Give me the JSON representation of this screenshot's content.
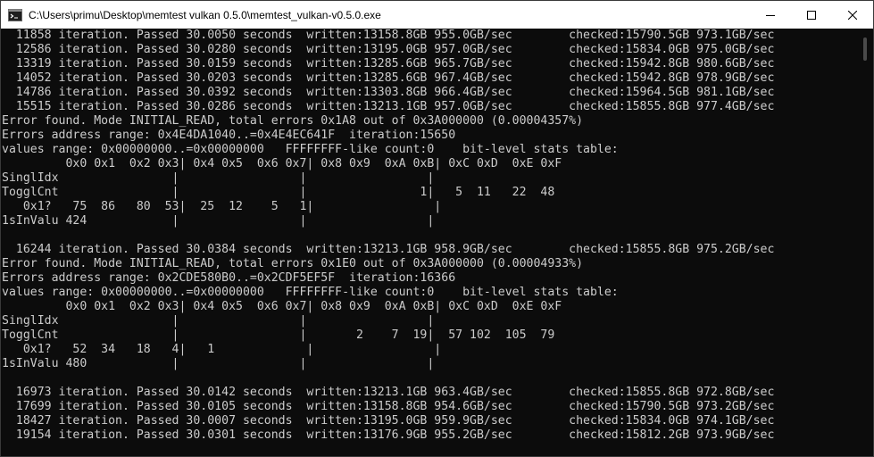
{
  "window": {
    "title": "C:\\Users\\primu\\Desktop\\memtest vulkan 0.5.0\\memtest_vulkan-v0.5.0.exe"
  },
  "colors": {
    "terminal_bg": "#0c0c0c",
    "terminal_fg": "#cccccc",
    "titlebar_bg": "#ffffff"
  },
  "icons": {
    "app": "console-app-icon",
    "minimize": "minimize-icon",
    "maximize": "maximize-icon",
    "close": "close-icon"
  },
  "console": {
    "lines": [
      "  11858 iteration. Passed 30.0050 seconds  written:13158.8GB 955.0GB/sec        checked:15790.5GB 973.1GB/sec",
      "  12586 iteration. Passed 30.0280 seconds  written:13195.0GB 957.0GB/sec        checked:15834.0GB 975.0GB/sec",
      "  13319 iteration. Passed 30.0159 seconds  written:13285.6GB 965.7GB/sec        checked:15942.8GB 980.6GB/sec",
      "  14052 iteration. Passed 30.0203 seconds  written:13285.6GB 967.4GB/sec        checked:15942.8GB 978.9GB/sec",
      "  14786 iteration. Passed 30.0392 seconds  written:13303.8GB 966.4GB/sec        checked:15964.5GB 981.1GB/sec",
      "  15515 iteration. Passed 30.0286 seconds  written:13213.1GB 957.0GB/sec        checked:15855.8GB 977.4GB/sec",
      "Error found. Mode INITIAL_READ, total errors 0x1A8 out of 0x3A000000 (0.00004357%)",
      "Errors address range: 0x4E4DA1040..=0x4E4EC641F  iteration:15650",
      "values range: 0x00000000..=0x00000000   FFFFFFFF-like count:0    bit-level stats table:",
      "         0x0 0x1  0x2 0x3| 0x4 0x5  0x6 0x7| 0x8 0x9  0xA 0xB| 0xC 0xD  0xE 0xF",
      "SinglIdx                |                 |                 |",
      "TogglCnt                |                 |                1|   5  11   22  48",
      "   0x1?   75  86   80  53|  25  12    5   1|                 |",
      "1sInValu 424            |                 |                 |",
      "",
      "  16244 iteration. Passed 30.0384 seconds  written:13213.1GB 958.9GB/sec        checked:15855.8GB 975.2GB/sec",
      "Error found. Mode INITIAL_READ, total errors 0x1E0 out of 0x3A000000 (0.00004933%)",
      "Errors address range: 0x2CDE580B0..=0x2CDF5EF5F  iteration:16366",
      "values range: 0x00000000..=0x00000000   FFFFFFFF-like count:0    bit-level stats table:",
      "         0x0 0x1  0x2 0x3| 0x4 0x5  0x6 0x7| 0x8 0x9  0xA 0xB| 0xC 0xD  0xE 0xF",
      "SinglIdx                |                 |                 |",
      "TogglCnt                |                 |       2    7  19|  57 102  105  79",
      "   0x1?   52  34   18   4|   1             |                 |",
      "1sInValu 480            |                 |                 |",
      "",
      "  16973 iteration. Passed 30.0142 seconds  written:13213.1GB 963.4GB/sec        checked:15855.8GB 972.8GB/sec",
      "  17699 iteration. Passed 30.0105 seconds  written:13158.8GB 954.6GB/sec        checked:15790.5GB 973.2GB/sec",
      "  18427 iteration. Passed 30.0007 seconds  written:13195.0GB 959.9GB/sec        checked:15834.0GB 974.1GB/sec",
      "  19154 iteration. Passed 30.0301 seconds  written:13176.9GB 955.2GB/sec        checked:15812.2GB 973.9GB/sec"
    ]
  }
}
